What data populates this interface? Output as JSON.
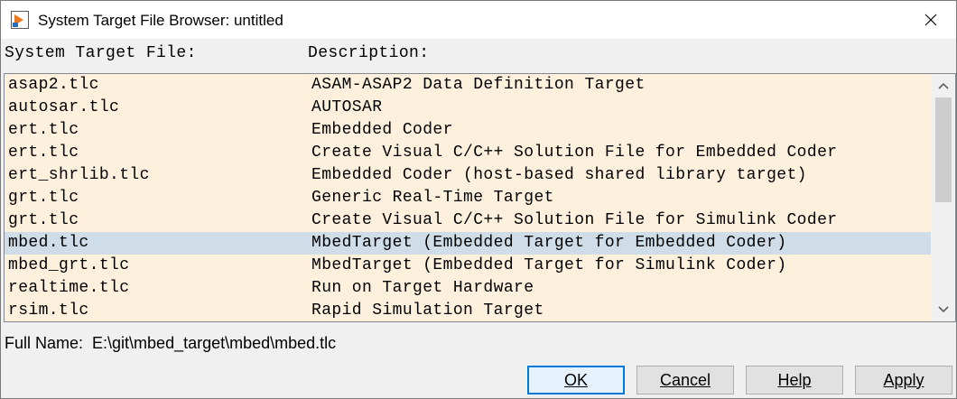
{
  "window": {
    "title": "System Target File Browser: untitled"
  },
  "columns": {
    "file": "System Target File:",
    "description": "Description:"
  },
  "rows": [
    {
      "file": "asap2.tlc",
      "description": "ASAM-ASAP2 Data Definition Target",
      "selected": false
    },
    {
      "file": "autosar.tlc",
      "description": "AUTOSAR",
      "selected": false
    },
    {
      "file": "ert.tlc",
      "description": "Embedded Coder",
      "selected": false
    },
    {
      "file": "ert.tlc",
      "description": "Create Visual C/C++ Solution File for Embedded Coder",
      "selected": false
    },
    {
      "file": "ert_shrlib.tlc",
      "description": "Embedded Coder (host-based shared library target)",
      "selected": false
    },
    {
      "file": "grt.tlc",
      "description": "Generic Real-Time Target",
      "selected": false
    },
    {
      "file": "grt.tlc",
      "description": "Create Visual C/C++ Solution File for Simulink Coder",
      "selected": false
    },
    {
      "file": "mbed.tlc",
      "description": "MbedTarget (Embedded Target for Embedded Coder)",
      "selected": true
    },
    {
      "file": "mbed_grt.tlc",
      "description": "MbedTarget (Embedded Target for Simulink Coder)",
      "selected": false
    },
    {
      "file": "realtime.tlc",
      "description": "Run on Target Hardware",
      "selected": false
    },
    {
      "file": "rsim.tlc",
      "description": "Rapid Simulation Target",
      "selected": false
    }
  ],
  "full_name": {
    "label": "Full Name:",
    "value": "E:\\git\\mbed_target\\mbed\\mbed.tlc"
  },
  "buttons": {
    "ok": "OK",
    "cancel": "Cancel",
    "help": "Help",
    "apply": "Apply"
  },
  "colors": {
    "list_background": "#fdf1dd",
    "selected_row": "#cfdde8",
    "default_button_border": "#0078d7"
  },
  "icons": {
    "app": "simulink-app-icon",
    "close": "close-icon",
    "scroll_up": "chevron-up-icon",
    "scroll_down": "chevron-down-icon"
  }
}
